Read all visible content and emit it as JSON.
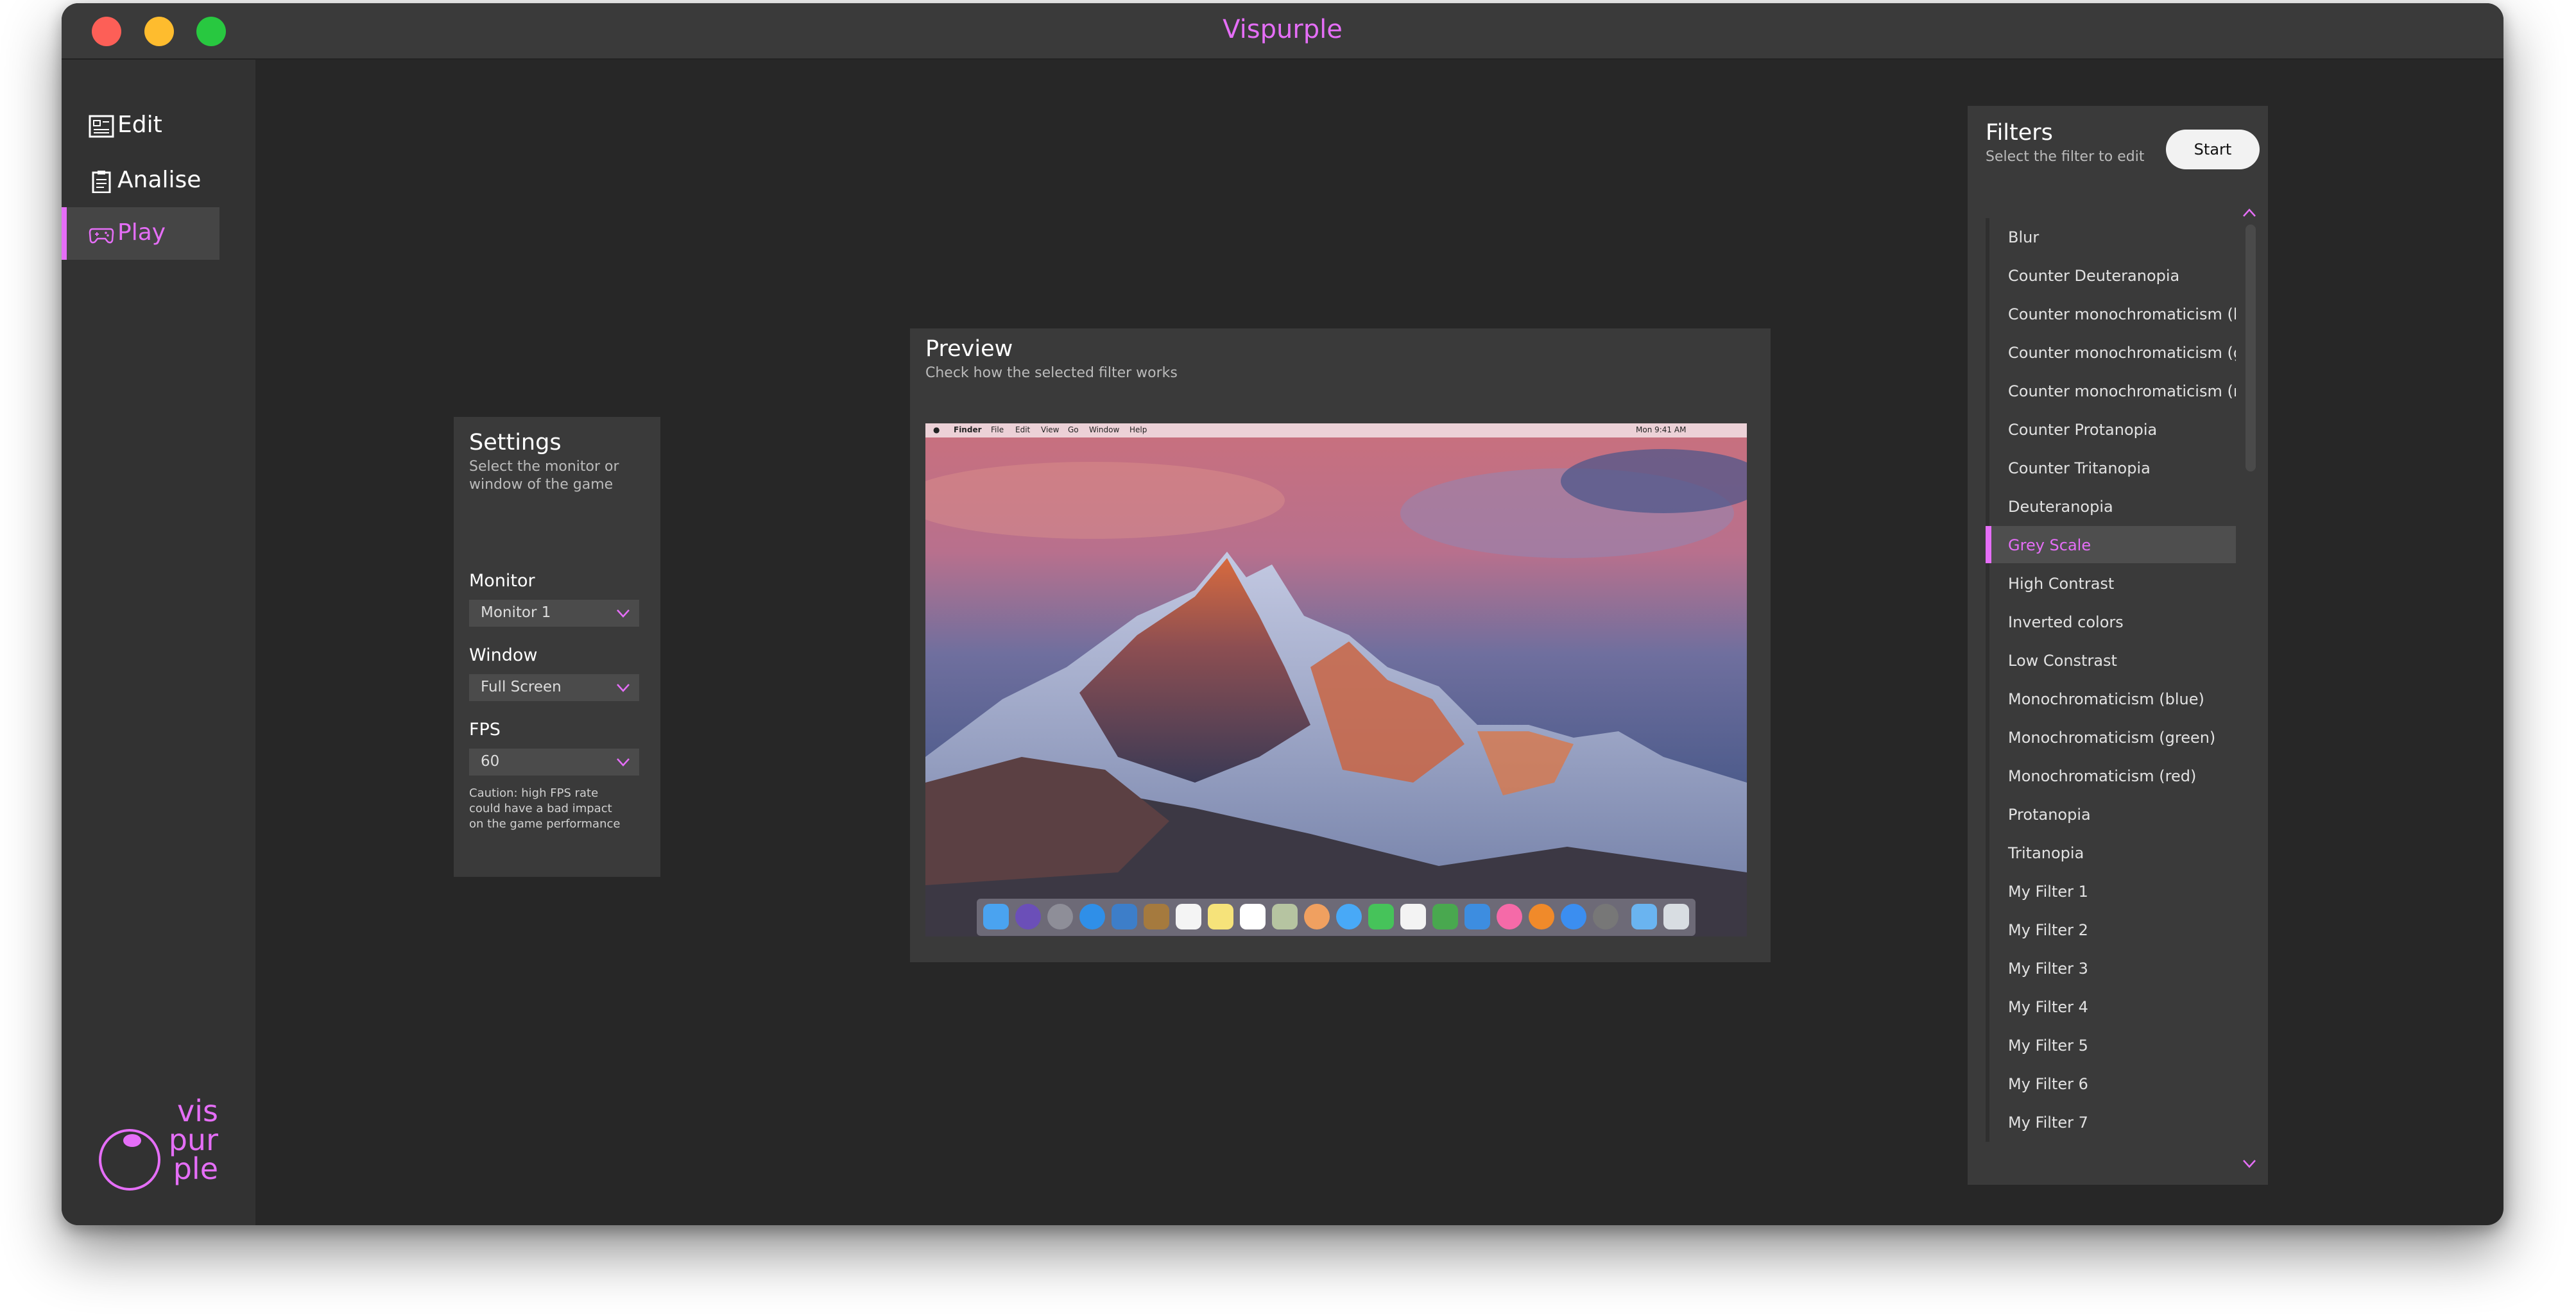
{
  "app": {
    "title": "Vispurple",
    "accent_color": "#e56ef7"
  },
  "window_controls": [
    "close",
    "minimize",
    "zoom"
  ],
  "sidebar": {
    "items": [
      {
        "label": "Edit",
        "icon": "edit-icon",
        "active": false
      },
      {
        "label": "Analise",
        "icon": "clipboard-icon",
        "active": false
      },
      {
        "label": "Play",
        "icon": "gamepad-icon",
        "active": true
      }
    ],
    "logo": {
      "line1": "vis",
      "line2": "pur",
      "line3": "ple"
    }
  },
  "settings": {
    "title": "Settings",
    "subtitle_line1": "Select the monitor or",
    "subtitle_line2": "window of the game",
    "monitor": {
      "label": "Monitor",
      "value": "Monitor 1"
    },
    "window": {
      "label": "Window",
      "value": "Full Screen"
    },
    "fps": {
      "label": "FPS",
      "value": "60"
    },
    "caution_line1": "Caution: high FPS rate",
    "caution_line2": "could have a bad impact",
    "caution_line3": "on the game performance"
  },
  "preview": {
    "title": "Preview",
    "subtitle": "Check how the selected filter works",
    "screenshot_menubar": {
      "items": [
        "Finder",
        "File",
        "Edit",
        "View",
        "Go",
        "Window",
        "Help"
      ],
      "clock": "Mon 9:41 AM"
    }
  },
  "filters": {
    "title": "Filters",
    "subtitle": "Select the filter to edit",
    "start_label": "Start",
    "selected": "Grey Scale",
    "items": [
      "Blur",
      "Counter Deuteranopia",
      "Counter monochromaticism (blue)",
      "Counter monochromaticism (gre...",
      "Counter monochromaticism (red)",
      "Counter Protanopia",
      "Counter Tritanopia",
      "Deuteranopia",
      "Grey Scale",
      "High Contrast",
      "Inverted colors",
      "Low Constrast",
      "Monochromaticism (blue)",
      "Monochromaticism (green)",
      "Monochromaticism (red)",
      "Protanopia",
      "Tritanopia",
      "My Filter 1",
      "My Filter 2",
      "My Filter 3",
      "My Filter 4",
      "My Filter 5",
      "My Filter 6",
      "My Filter 7"
    ]
  }
}
